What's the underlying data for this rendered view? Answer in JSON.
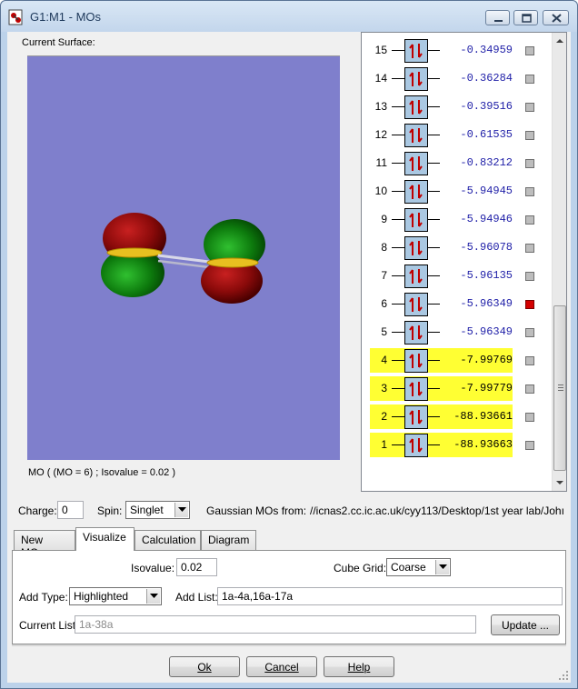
{
  "window": {
    "title": "G1:M1 - MOs",
    "icon": "gaussview-molecule-icon"
  },
  "surface": {
    "label": "Current Surface:",
    "background": "#7f7fcc",
    "status": "MO ( (MO = 6) ; Isovalue = 0.02 )"
  },
  "mo_list": {
    "rows": [
      {
        "num": "15",
        "energy": "-0.34959",
        "highlight": false,
        "selected": false
      },
      {
        "num": "14",
        "energy": "-0.36284",
        "highlight": false,
        "selected": false
      },
      {
        "num": "13",
        "energy": "-0.39516",
        "highlight": false,
        "selected": false
      },
      {
        "num": "12",
        "energy": "-0.61535",
        "highlight": false,
        "selected": false
      },
      {
        "num": "11",
        "energy": "-0.83212",
        "highlight": false,
        "selected": false
      },
      {
        "num": "10",
        "energy": "-5.94945",
        "highlight": false,
        "selected": false
      },
      {
        "num": "9",
        "energy": "-5.94946",
        "highlight": false,
        "selected": false
      },
      {
        "num": "8",
        "energy": "-5.96078",
        "highlight": false,
        "selected": false
      },
      {
        "num": "7",
        "energy": "-5.96135",
        "highlight": false,
        "selected": false
      },
      {
        "num": "6",
        "energy": "-5.96349",
        "highlight": false,
        "selected": true
      },
      {
        "num": "5",
        "energy": "-5.96349",
        "highlight": false,
        "selected": false
      },
      {
        "num": "4",
        "energy": "-7.99769",
        "highlight": true,
        "selected": false
      },
      {
        "num": "3",
        "energy": "-7.99779",
        "highlight": true,
        "selected": false
      },
      {
        "num": "2",
        "energy": "-88.93661",
        "highlight": true,
        "selected": false
      },
      {
        "num": "1",
        "energy": "-88.93663",
        "highlight": true,
        "selected": false
      }
    ],
    "highlight_color": "#ffff33",
    "selected_color": "#d40000"
  },
  "params": {
    "charge_label": "Charge:",
    "charge_value": "0",
    "spin_label": "Spin:",
    "spin_value": "Singlet",
    "source_label": "Gaussian MOs from:",
    "source_value": "//icnas2.cc.ic.ac.uk/cyy113/Desktop/1st year lab/Johı"
  },
  "tabs": [
    {
      "label": "New MOs",
      "active": false
    },
    {
      "label": "Visualize",
      "active": true
    },
    {
      "label": "Calculation",
      "active": false
    },
    {
      "label": "Diagram",
      "active": false
    }
  ],
  "visualize": {
    "isovalue_label": "Isovalue:",
    "isovalue_value": "0.02",
    "cube_grid_label": "Cube Grid:",
    "cube_grid_value": "Coarse",
    "add_type_label": "Add Type:",
    "add_type_value": "Highlighted",
    "add_list_label": "Add List:",
    "add_list_value": "1a-4a,16a-17a",
    "current_list_label": "Current List:",
    "current_list_placeholder": "1a-38a",
    "update_label": "Update ..."
  },
  "buttons": {
    "ok": "Ok",
    "cancel": "Cancel",
    "help": "Help"
  }
}
